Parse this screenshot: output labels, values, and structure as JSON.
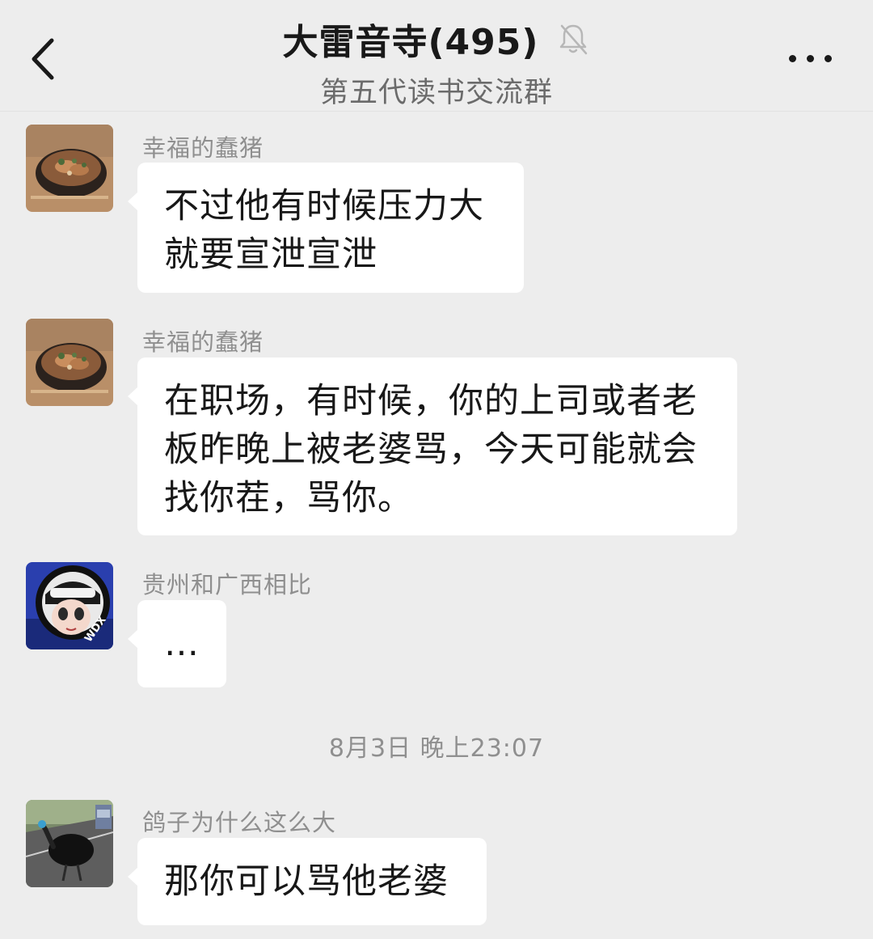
{
  "header": {
    "title": "大雷音寺(495)",
    "subtitle": "第五代读书交流群",
    "back_icon": "chevron-left-icon",
    "mute_icon": "bell-off-icon",
    "more_icon": "ellipsis-icon"
  },
  "messages": [
    {
      "sender": "幸福的蠢猪",
      "text": "不过他有时候压力大\n就要宣泄宣泄",
      "avatar": "food-photo-avatar"
    },
    {
      "sender": "幸福的蠢猪",
      "text": "在职场，有时候，你的上司或者老\n板昨晚上被老婆骂，今天可能就会\n找你茬，骂你。",
      "avatar": "food-photo-avatar"
    },
    {
      "sender": "贵州和广西相比",
      "text": "…",
      "avatar": "anime-helmet-avatar"
    },
    {
      "sender": "鸽子为什么这么大",
      "text": "那你可以骂他老婆",
      "avatar": "cassowary-photo-avatar"
    }
  ],
  "timestamp": "8月3日 晚上23:07",
  "colors": {
    "background": "#ededed",
    "bubble": "#ffffff",
    "sender": "#8f8f8f",
    "text": "#181818"
  }
}
